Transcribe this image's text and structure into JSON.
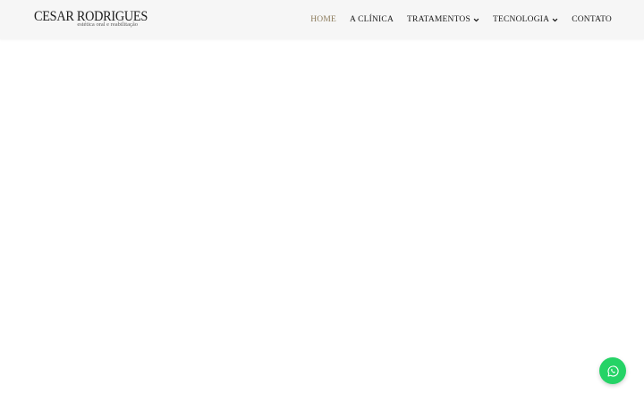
{
  "header": {
    "logo": {
      "name": "CESAR RODRIGUES",
      "tagline": "estética oral e reabilitação"
    },
    "nav": [
      {
        "label": "HOME",
        "active": true,
        "dropdown": false
      },
      {
        "label": "A CLÍNICA",
        "active": false,
        "dropdown": false
      },
      {
        "label": "TRATAMENTOS",
        "active": false,
        "dropdown": true
      },
      {
        "label": "TECNOLOGIA",
        "active": false,
        "dropdown": true
      },
      {
        "label": "CONTATO",
        "active": false,
        "dropdown": false
      }
    ]
  },
  "floating": {
    "icon": "whatsapp-icon"
  },
  "colors": {
    "header_bg": "#f6f6f6",
    "active_nav": "#8b7a5a",
    "text": "#1b1b1b",
    "whatsapp": "#25d366"
  }
}
